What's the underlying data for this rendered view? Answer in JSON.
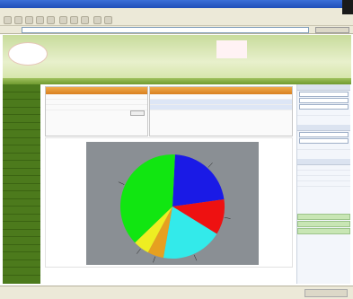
{
  "window": {
    "title": ""
  },
  "menu": {
    "items": []
  },
  "address": {
    "label": "",
    "url": "",
    "go": ""
  },
  "banner": {
    "tagline": "",
    "subtitle": ""
  },
  "nav": {
    "strip": []
  },
  "sidebar": {
    "items": [
      "",
      "",
      "",
      "",
      "",
      "",
      "",
      "",
      "",
      "",
      "",
      "",
      "",
      "",
      "",
      "",
      "",
      "",
      "",
      "",
      "",
      "",
      "",
      "",
      ""
    ]
  },
  "panels": {
    "left": {
      "title": "",
      "rows": [
        "",
        "",
        ""
      ]
    },
    "right": {
      "title": "",
      "rows": [
        "",
        "",
        ""
      ]
    }
  },
  "rightbar": {
    "sections": [
      "",
      "",
      ""
    ]
  },
  "status": {
    "left": "",
    "right": ""
  },
  "colors": {
    "accent": "#e98b2a",
    "nav": "#4c7a1c",
    "banner": "#d5e5a8"
  },
  "chart_data": {
    "type": "pie",
    "title": "",
    "slices": [
      {
        "label": "",
        "value": 22,
        "color": "#1a1ae6"
      },
      {
        "label": "",
        "value": 11,
        "color": "#ee1111"
      },
      {
        "label": "",
        "value": 19,
        "color": "#33eaea"
      },
      {
        "label": "",
        "value": 5,
        "color": "#e6a020"
      },
      {
        "label": "",
        "value": 5,
        "color": "#eeee22"
      },
      {
        "label": "",
        "value": 38,
        "color": "#11e611"
      }
    ]
  }
}
